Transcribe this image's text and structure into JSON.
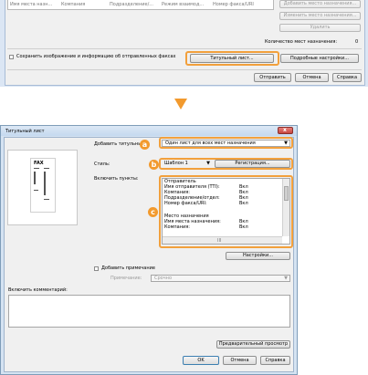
{
  "top": {
    "col_headers": [
      "Имя места назн...",
      "Компания",
      "Подразделение/...",
      "Режим взаимод...",
      "Номер факса/URI"
    ],
    "buttons": {
      "add_dest": "Добавить место назначения...",
      "edit_dest": "Изменить место назначения...",
      "delete": "Удалить"
    },
    "count_label": "Количество мест назначения:",
    "count_value": "0",
    "save_checkbox_label": "Сохранить изображение и информацию об отправленных факсах",
    "cover_button": "Титульный лист...",
    "settings_button": "Подробные настройки...",
    "send_button": "Отправить",
    "cancel_button": "Отмена",
    "help_button": "Справка"
  },
  "dialog": {
    "title": "Титульный лист",
    "close_glyph": "x",
    "add_cover_label": "Добавить титульный",
    "add_cover_value": "Один лист для всех мест назначения",
    "style_label": "Стиль:",
    "style_value": "Шаблон 1",
    "register_button": "Регистрация...",
    "include_label": "Включить пункты:",
    "list_items": [
      {
        "name": "Отправитель",
        "value": ""
      },
      {
        "name": "Имя отправителя (TTI):",
        "value": "Вкл"
      },
      {
        "name": "Компания:",
        "value": "Вкл"
      },
      {
        "name": "Подразделение/отдел:",
        "value": "Вкл"
      },
      {
        "name": "Номер факса/URI:",
        "value": "Вкл"
      },
      {
        "name": "",
        "value": ""
      },
      {
        "name": "Место назначения",
        "value": ""
      },
      {
        "name": "Имя места назначения:",
        "value": "Вкл"
      },
      {
        "name": "Компания:",
        "value": "Вкл"
      }
    ],
    "list_scroll_mark": "III",
    "settings_button": "Настройки...",
    "add_note_label": "Добавить примечание",
    "note_type_label": "Примечание:",
    "note_type_value": "Срочно",
    "comment_label": "Включить комментарий:",
    "preview_button": "Предварительный просмотр",
    "ok_button": "OK",
    "cancel_button": "Отмена",
    "help_button": "Справка",
    "preview_fax_text": "FAX"
  },
  "badges": {
    "a": "a",
    "b": "b",
    "c": "c"
  },
  "colors": {
    "accent": "#f29a2e",
    "arrow": "#f29a2e",
    "titlebar": "#c5d9ef",
    "close": "#d2544c"
  }
}
